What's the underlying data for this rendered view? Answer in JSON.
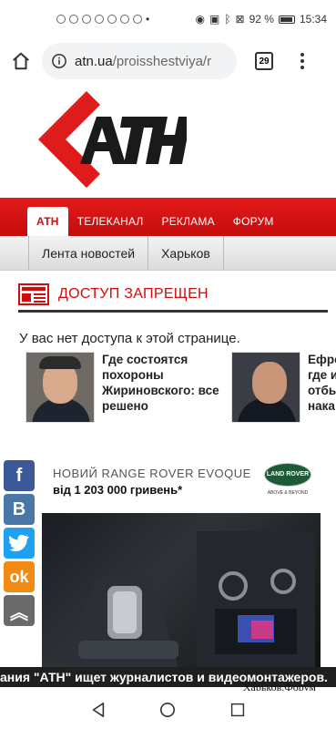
{
  "status": {
    "battery": "92 %",
    "time": "15:34"
  },
  "browser": {
    "url_domain": "atn.ua",
    "url_path": "/proisshestviya/r",
    "tab_count": "29"
  },
  "nav": {
    "items": [
      "АТН",
      "ТЕЛЕКАНАЛ",
      "РЕКЛАМА",
      "ФОРУМ"
    ],
    "sub_items": [
      "Лента новостей",
      "Харьков"
    ]
  },
  "notice": {
    "title": "ДОСТУП ЗАПРЕЩЕН",
    "message": "У вас нет доступа к этой странице."
  },
  "related": [
    {
      "title": "Где состоятся похороны Жириновского: все решено"
    },
    {
      "title": "Ефре где и отбы нака"
    }
  ],
  "ad": {
    "title": "НОВИЙ RANGE ROVER EVOQUE",
    "price": "від 1 203 000 гривень*",
    "brand": "LAND ROVER",
    "slogan": "ABOVE & BEYOND"
  },
  "ticker": {
    "text": "ания \"АТН\" ищет журналистов и видеомонтажеров.",
    "right": "Харьков.Форум"
  },
  "colors": {
    "accent": "#d20c0c",
    "facebook": "#3b5998",
    "vk": "#4a76a8",
    "twitter": "#1da1f2",
    "ok": "#f18b13"
  }
}
